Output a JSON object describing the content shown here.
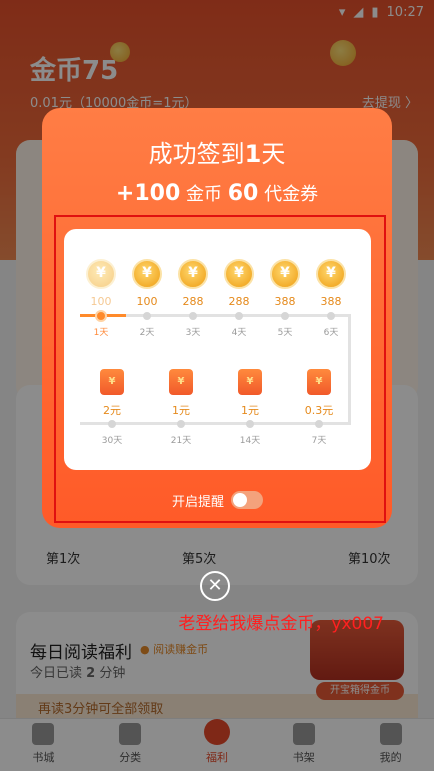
{
  "status": {
    "time": "10:27",
    "icons": [
      "wifi-icon",
      "signal-icon",
      "battery-icon"
    ]
  },
  "header": {
    "title": "金币75",
    "subtitle": "0.01元（10000金币=1元）",
    "withdraw": "去提现 〉"
  },
  "background": {
    "ticks": [
      "第1次",
      "第5次",
      "第10次"
    ]
  },
  "read_card": {
    "title": "每日阅读福利",
    "badge": "阅读赚金币",
    "today_prefix": "今日已读",
    "today_value": "2",
    "today_unit": "分钟",
    "bottom_text": "再读3分钟可全部领取",
    "chest_label": "开宝箱得金币"
  },
  "modal": {
    "title_prefix": "成功签到",
    "title_count": "1",
    "title_suffix": "天",
    "reward_plus": "+100",
    "reward_coin_label": "金币",
    "reward_voucher": "60",
    "reward_voucher_label": "代金券",
    "row1": [
      {
        "amount": "100",
        "day": "1天"
      },
      {
        "amount": "100",
        "day": "2天"
      },
      {
        "amount": "288",
        "day": "3天"
      },
      {
        "amount": "288",
        "day": "4天"
      },
      {
        "amount": "388",
        "day": "5天"
      },
      {
        "amount": "388",
        "day": "6天"
      }
    ],
    "row2": [
      {
        "amount": "2元",
        "day": "30天"
      },
      {
        "amount": "1元",
        "day": "21天"
      },
      {
        "amount": "1元",
        "day": "14天"
      },
      {
        "amount": "0.3元",
        "day": "7天"
      }
    ],
    "remind_label": "开启提醒",
    "close_symbol": "✕"
  },
  "annotation": "老登给我爆点金币，yx007",
  "tabs": [
    {
      "label": "书城",
      "icon": "bookstore-icon"
    },
    {
      "label": "分类",
      "icon": "category-icon"
    },
    {
      "label": "福利",
      "icon": "welfare-icon"
    },
    {
      "label": "书架",
      "icon": "bookshelf-icon"
    },
    {
      "label": "我的",
      "icon": "profile-icon"
    }
  ],
  "colors": {
    "accent": "#ff6a33",
    "coin": "#f3ae2d",
    "annotation": "#ff2020"
  }
}
